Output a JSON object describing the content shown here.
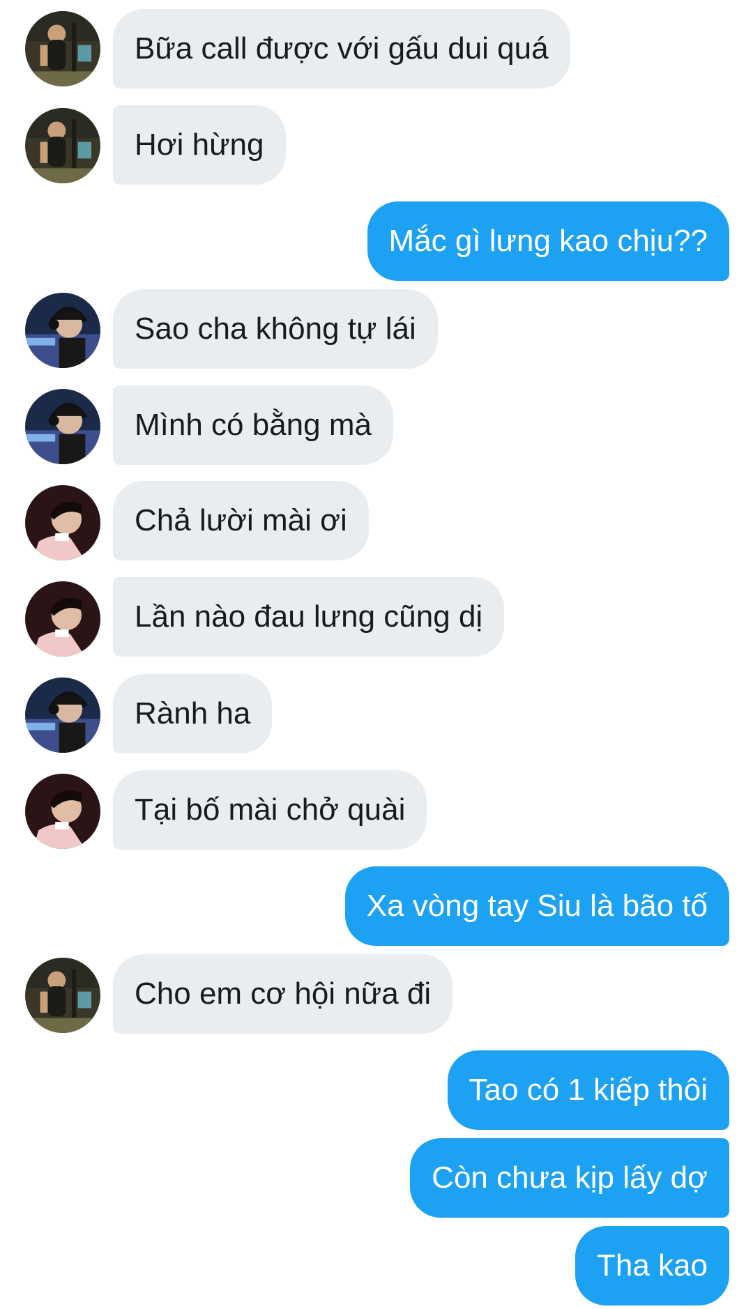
{
  "colors": {
    "incoming_bubble": "#e9edf0",
    "outgoing_bubble": "#1da1f2",
    "incoming_text": "#1a1a1a",
    "outgoing_text": "#ffffff"
  },
  "avatars": {
    "a": "avatar-gym-guy",
    "b": "avatar-headphones-guy",
    "c": "avatar-dark-hair-guy"
  },
  "messages": [
    {
      "direction": "incoming",
      "avatar": "a",
      "text": "Bữa call được với gấu dui quá"
    },
    {
      "direction": "incoming",
      "avatar": "a",
      "text": "Hơi hừng"
    },
    {
      "direction": "outgoing",
      "text": "Mắc gì lưng kao chịu??"
    },
    {
      "direction": "incoming",
      "avatar": "b",
      "text": "Sao cha không tự lái"
    },
    {
      "direction": "incoming",
      "avatar": "b",
      "text": "Mình có bằng mà"
    },
    {
      "direction": "incoming",
      "avatar": "c",
      "text": "Chả lười mài ơi"
    },
    {
      "direction": "incoming",
      "avatar": "c",
      "text": "Lần nào đau lưng cũng dị"
    },
    {
      "direction": "incoming",
      "avatar": "b",
      "text": "Rành ha"
    },
    {
      "direction": "incoming",
      "avatar": "c",
      "text": "Tại bố mài chở quài"
    },
    {
      "direction": "outgoing",
      "text": "Xa vòng tay Siu là bão tố"
    },
    {
      "direction": "incoming",
      "avatar": "a",
      "text": "Cho em cơ hội nữa đi"
    },
    {
      "direction": "outgoing",
      "text": "Tao có 1 kiếp thôi"
    },
    {
      "direction": "outgoing",
      "text": "Còn chưa kịp lấy dợ"
    },
    {
      "direction": "outgoing",
      "text": "Tha kao"
    }
  ]
}
